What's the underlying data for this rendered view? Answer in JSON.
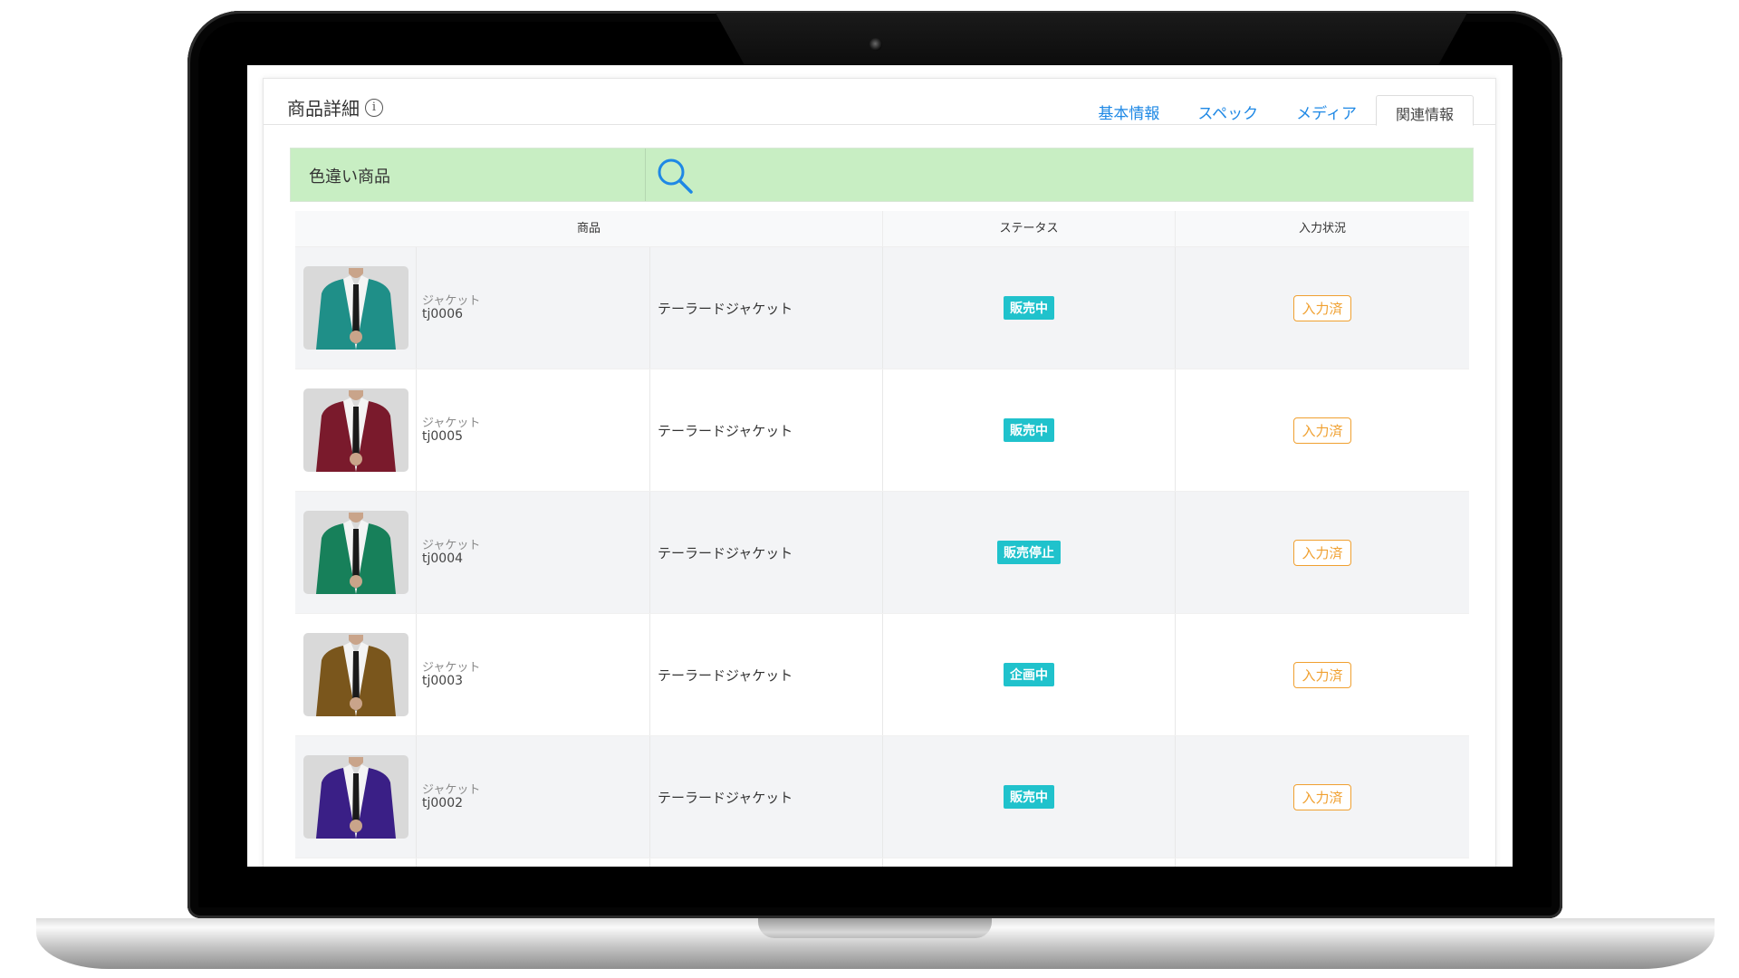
{
  "header": {
    "title": "商品詳細",
    "tabs": [
      {
        "label": "基本情報"
      },
      {
        "label": "スペック"
      },
      {
        "label": "メディア"
      },
      {
        "label": "関連情報"
      }
    ],
    "active_tab": "関連情報"
  },
  "search": {
    "label": "色違い商品"
  },
  "table": {
    "columns": [
      "商品",
      "ステータス",
      "入力状況"
    ],
    "rows": [
      {
        "type": "ジャケット",
        "code": "tj0006",
        "name": "テーラードジャケット",
        "status": "販売中",
        "input": "入力済",
        "jacket_color": "#1f8f88"
      },
      {
        "type": "ジャケット",
        "code": "tj0005",
        "name": "テーラードジャケット",
        "status": "販売中",
        "input": "入力済",
        "jacket_color": "#7a1a2c"
      },
      {
        "type": "ジャケット",
        "code": "tj0004",
        "name": "テーラードジャケット",
        "status": "販売停止",
        "input": "入力済",
        "jacket_color": "#17805a"
      },
      {
        "type": "ジャケット",
        "code": "tj0003",
        "name": "テーラードジャケット",
        "status": "企画中",
        "input": "入力済",
        "jacket_color": "#7a561c"
      },
      {
        "type": "ジャケット",
        "code": "tj0002",
        "name": "テーラードジャケット",
        "status": "販売中",
        "input": "入力済",
        "jacket_color": "#3a1f86"
      }
    ]
  },
  "colors": {
    "accent": "#1e88e5",
    "status_badge": "#20c2cc",
    "input_badge": "#f0a030",
    "search_bar": "#c8eec3"
  }
}
